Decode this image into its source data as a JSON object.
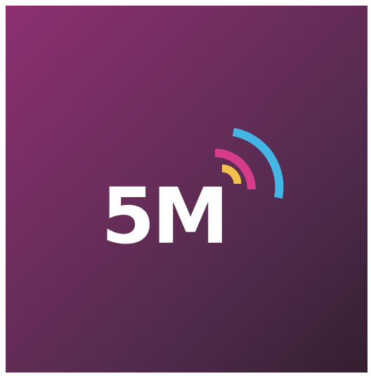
{
  "logo": {
    "text": "5M",
    "icon": "signal-waves-icon",
    "colors": {
      "background_start": "#8e2f70",
      "background_end": "#331f30",
      "text": "#ffffff",
      "wave_inner": "#f2c14e",
      "wave_middle": "#d63c8c",
      "wave_outer": "#45b5e6"
    }
  }
}
